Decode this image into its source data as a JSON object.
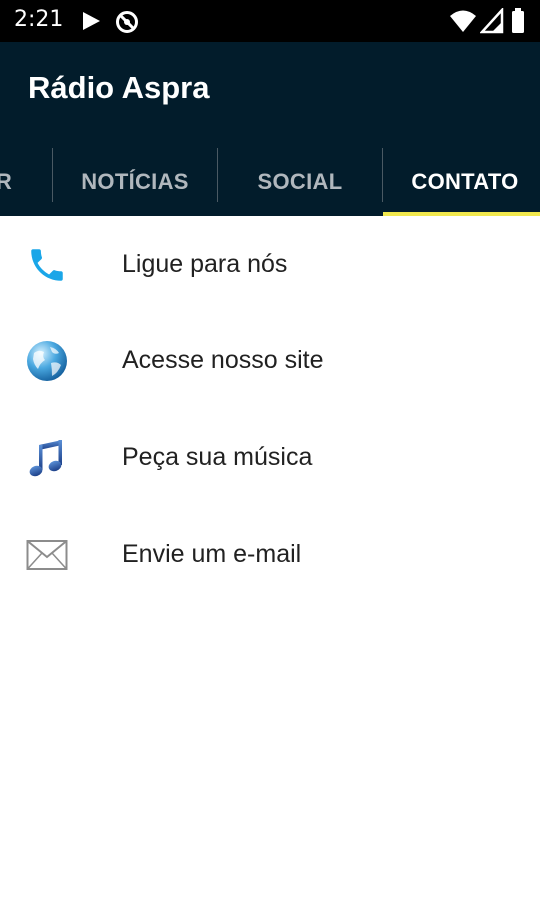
{
  "status_bar": {
    "time": "2:21",
    "icons": [
      "play-icon",
      "no-sync-icon",
      "wifi-icon",
      "signal-icon",
      "battery-icon"
    ]
  },
  "app": {
    "title": "Rádio Aspra",
    "colors": {
      "appbar": "#021c2b",
      "indicator": "#f1e84e"
    }
  },
  "tabs": [
    {
      "label": "R",
      "active": false
    },
    {
      "label": "NOTÍCIAS",
      "active": false
    },
    {
      "label": "SOCIAL",
      "active": false
    },
    {
      "label": "CONTATO",
      "active": true
    }
  ],
  "contact_items": [
    {
      "icon": "phone-icon",
      "label": "Ligue para nós"
    },
    {
      "icon": "globe-icon",
      "label": "Acesse nosso site"
    },
    {
      "icon": "music-note-icon",
      "label": "Peça sua música"
    },
    {
      "icon": "envelope-icon",
      "label": "Envie um e-mail"
    }
  ]
}
